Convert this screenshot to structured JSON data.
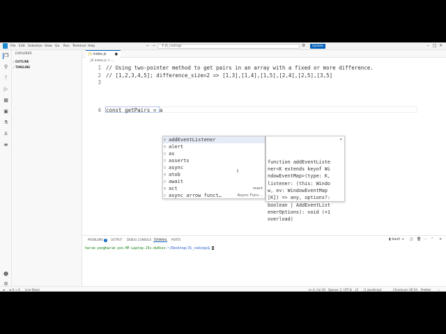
{
  "menu": [
    "File",
    "Edit",
    "Selection",
    "View",
    "Go",
    "Run",
    "Terminal",
    "Help"
  ],
  "command_center": {
    "text": "JS_codings"
  },
  "update_label": "Update",
  "activity_icons": [
    "files-icon",
    "search-icon",
    "source-control-icon",
    "run-debug-icon",
    "extensions-icon",
    "remote-icon",
    "testing-icon",
    "docker-icon",
    "database-icon"
  ],
  "sidebar": {
    "title": "EXPLORER",
    "sections": [
      "OUTLINE",
      "TIMELINE"
    ]
  },
  "tab": {
    "label": "index.js"
  },
  "breadcrumb": "JS index.js > ...",
  "code_lines": [
    {
      "n": "1",
      "text": "// Using two-pointer method to get pairs in an array with a fixed or more difference."
    },
    {
      "n": "2",
      "text": "// [1,2,3,4,5]; difference_size=2 => [1,3],[1,4],[1,5],[2,4],[2,5],[3,5]"
    },
    {
      "n": "3",
      "text": ""
    },
    {
      "n": "4",
      "text": "const getPairs = a"
    }
  ],
  "suggestions": [
    {
      "label": "addEventListener",
      "detail": ""
    },
    {
      "label": "alert",
      "detail": ""
    },
    {
      "label": "as",
      "detail": ""
    },
    {
      "label": "asserts",
      "detail": ""
    },
    {
      "label": "async",
      "detail": ""
    },
    {
      "label": "atob",
      "detail": ""
    },
    {
      "label": "await",
      "detail": ""
    },
    {
      "label": "act",
      "detail": "react"
    },
    {
      "label": "async arrow funct…",
      "detail": "Async Func…"
    }
  ],
  "docs_text": "function addEventListe\nner<K extends keyof Wi\nndowEventMap>(type: K,\nlistener: (this: Windo\nw, ev: WindowEventMap\n[K]) => any, options?:\nboolean | AddEventList\nenerOptions): void (+1\noverload)",
  "panel": {
    "tabs": [
      "PROBLEMS",
      "OUTPUT",
      "DEBUG CONSOLE",
      "TERMINAL",
      "PORTS"
    ],
    "problems_count": "1",
    "shell_label": "bash",
    "terminal_user": "harim-yoo@harim-yoo-HP-Laptop-15s-du0xxx",
    "terminal_path": ":~/Desktop/JS_codings$ "
  },
  "status": {
    "remote": "⊗ 0 ⚠ 0",
    "live_share": "Live Share",
    "position": "Ln 4, Col 19",
    "spaces": "Spaces: 2",
    "encoding": "UTF-8",
    "eol": "LF",
    "language": "{} JavaScript",
    "chromium": "Chromium: 00:54",
    "prettier": "Prettier"
  }
}
